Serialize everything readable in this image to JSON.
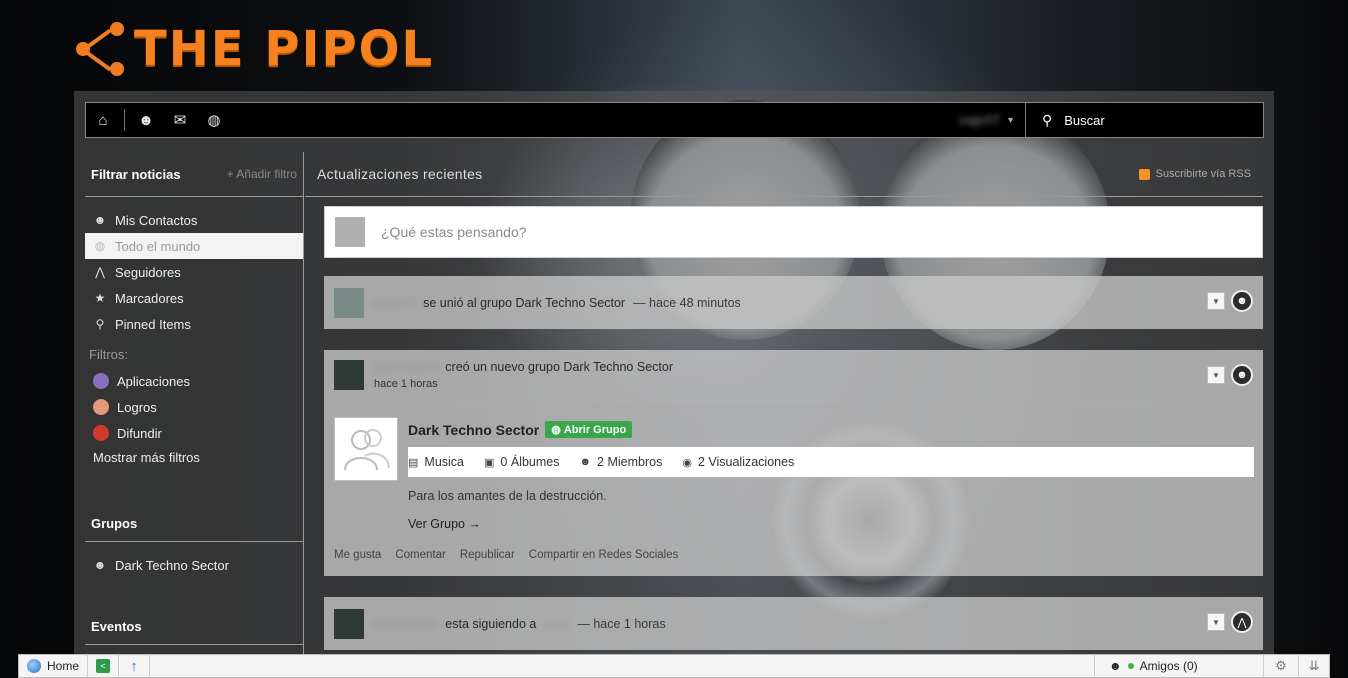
{
  "brand": {
    "name": "THE PIPOL",
    "color": "#f5821f"
  },
  "toolbar": {
    "icons": [
      "home-icon",
      "user-icon",
      "mail-icon",
      "globe-icon"
    ],
    "username": "cogoXT",
    "search_placeholder": "Buscar"
  },
  "sidebar": {
    "filter_title": "Filtrar noticias",
    "add_filter": "+ Añadir filtro",
    "items": [
      {
        "label": "Mis Contactos",
        "icon": "user-icon"
      },
      {
        "label": "Todo el mundo",
        "icon": "globe-icon",
        "active": true
      },
      {
        "label": "Seguidores",
        "icon": "followers-icon"
      },
      {
        "label": "Marcadores",
        "icon": "star-icon"
      },
      {
        "label": "Pinned Items",
        "icon": "pin-icon"
      }
    ],
    "filters_label": "Filtros:",
    "filters": [
      {
        "label": "Aplicaciones",
        "color": "#8a6fc0"
      },
      {
        "label": "Logros",
        "color": "#e39a7a"
      },
      {
        "label": "Difundir",
        "color": "#d23a2a"
      }
    ],
    "more_filters": "Mostrar más filtros",
    "groups_title": "Grupos",
    "groups": [
      {
        "label": "Dark Techno Sector"
      }
    ],
    "events_title": "Eventos"
  },
  "content": {
    "title": "Actualizaciones recientes",
    "rss": "Suscribirte vía RSS",
    "composer_placeholder": "¿Qué estas pensando?",
    "feed": [
      {
        "user": "cogoXT",
        "text": "se unió al grupo Dark Techno Sector",
        "time": "— hace 48 minutos"
      },
      {
        "user": "Mercoveme",
        "text": "creó un nuevo grupo Dark Techno Sector",
        "time": "hace 1 horas",
        "group": {
          "name": "Dark Techno Sector",
          "open_label": "Abrir Grupo",
          "category": "Musica",
          "albums": "0 Álbumes",
          "members": "2 Miembros",
          "views": "2 Visualizaciones",
          "description": "Para los amantes de la destrucción.",
          "link": "Ver Grupo →"
        },
        "actions": [
          "Me gusta",
          "Comentar",
          "Republicar",
          "Compartir en Redes Sociales"
        ]
      },
      {
        "user": "Mercoveme",
        "text": "esta siguiendo a",
        "target": "xxxx",
        "time": "— hace 1 horas"
      }
    ]
  },
  "bottombar": {
    "home": "Home",
    "friends": "Amigos (0)"
  }
}
